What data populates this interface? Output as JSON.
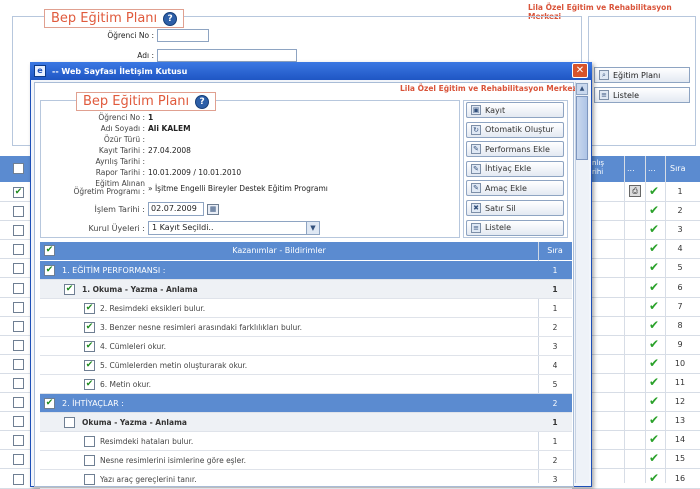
{
  "background": {
    "brand": "Lila Özel Eğitim ve Rehabilitasyon Merkezi",
    "legend": "Bep Eğitim Planı",
    "fields": [
      {
        "label": "Öğrenci No :"
      },
      {
        "label": "Adı :"
      }
    ],
    "side_buttons": [
      {
        "icon": "search-icon",
        "label": "Eğitim Planı"
      },
      {
        "icon": "list-icon",
        "label": "Listele"
      }
    ],
    "table": {
      "header_partial": "nlış\nrihi",
      "header_dots1": "...",
      "header_dots2": "...",
      "header_sira": "Sıra",
      "row_numbers": [
        "1",
        "2",
        "3",
        "4",
        "5",
        "6",
        "7",
        "8",
        "9",
        "10",
        "11",
        "12",
        "13",
        "14",
        "15",
        "16"
      ]
    }
  },
  "dialog": {
    "title": "-- Web Sayfası İletişim Kutusu",
    "brand": "Lila Özel Eğitim ve Rehabilitasyon Merkezi",
    "legend": "Bep Eğitim Planı",
    "fields": {
      "ogrenci_no": {
        "label": "Öğrenci No :",
        "value": "1"
      },
      "adi_soyadi": {
        "label": "Adı Soyadı :",
        "value": "Ali KALEM"
      },
      "ozur_turu": {
        "label": "Özür Türü :",
        "value": ""
      },
      "kayit_tarihi": {
        "label": "Kayıt Tarihi :",
        "value": "27.04.2008"
      },
      "ayrilis_tarihi": {
        "label": "Ayrılış Tarihi :",
        "value": ""
      },
      "rapor_tarihi": {
        "label": "Rapor Tarihi :",
        "value": "10.01.2009 / 10.01.2010"
      },
      "program": {
        "label1": "Eğitim Alınan",
        "label2": "Öğretim Programı :",
        "value": "» İşitme Engelli Bireyler Destek Eğitim Programı"
      },
      "islem_tarihi": {
        "label": "İşlem Tarihi :",
        "value": "02.07.2009"
      },
      "kurul": {
        "label": "Kurul Üyeleri :",
        "value": "1 Kayıt Seçildi.."
      }
    },
    "buttons": [
      {
        "icon": "save-icon",
        "label": "Kayıt"
      },
      {
        "icon": "refresh-icon",
        "label": "Otomatik Oluştur"
      },
      {
        "icon": "edit-icon",
        "label": "Performans Ekle"
      },
      {
        "icon": "edit-icon",
        "label": "İhtiyaç Ekle"
      },
      {
        "icon": "edit-icon",
        "label": "Amaç Ekle"
      },
      {
        "icon": "trash-icon",
        "label": "Satır Sil"
      },
      {
        "icon": "list-icon",
        "label": "Listele"
      }
    ],
    "table": {
      "header": "Kazanımlar - Bildirimler",
      "header_sira": "Sıra",
      "rows": [
        {
          "type": "section",
          "text": "1. EĞİTİM PERFORMANSI :",
          "sira": "1",
          "checked": true
        },
        {
          "type": "group",
          "text": "1. Okuma - Yazma - Anlama",
          "sira": "1",
          "checked": true
        },
        {
          "type": "item",
          "text": "2. Resimdeki eksikleri bulur.",
          "sira": "1",
          "checked": true
        },
        {
          "type": "item",
          "text": "3. Benzer nesne resimleri arasındaki farklılıkları bulur.",
          "sira": "2",
          "checked": true
        },
        {
          "type": "item",
          "text": "4. Cümleleri okur.",
          "sira": "3",
          "checked": true
        },
        {
          "type": "item",
          "text": "5. Cümlelerden metin oluşturarak okur.",
          "sira": "4",
          "checked": true
        },
        {
          "type": "item",
          "text": "6. Metin okur.",
          "sira": "5",
          "checked": true
        },
        {
          "type": "section",
          "text": "2. İHTİYAÇLAR :",
          "sira": "2",
          "checked": true
        },
        {
          "type": "group",
          "text": "Okuma - Yazma - Anlama",
          "sira": "1",
          "checked": false
        },
        {
          "type": "item",
          "text": "Resimdeki hataları bulur.",
          "sira": "1",
          "checked": false
        },
        {
          "type": "item",
          "text": "Nesne resimlerini isimlerine göre eşler.",
          "sira": "2",
          "checked": false
        },
        {
          "type": "item",
          "text": "Yazı araç gereçlerini tanır.",
          "sira": "3",
          "checked": false
        }
      ]
    }
  },
  "colors": {
    "title_bar": "#2b62c9",
    "section_row": "#5b8bd0",
    "brand": "#d9543a"
  }
}
